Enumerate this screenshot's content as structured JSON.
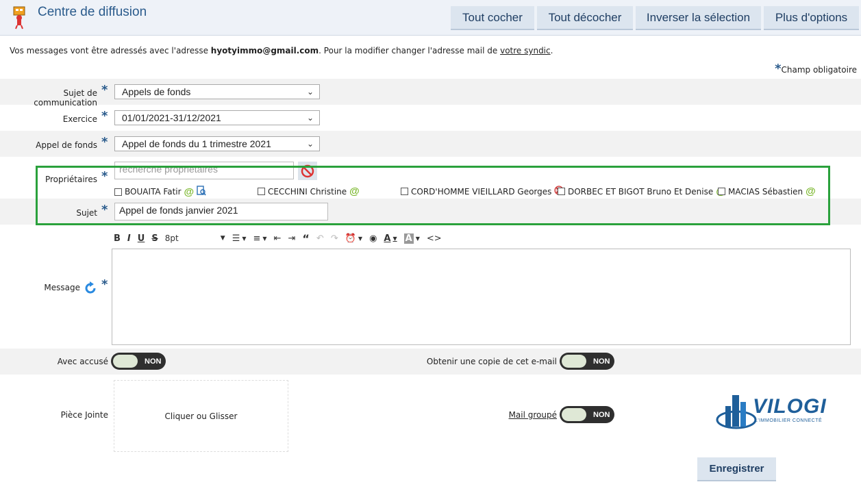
{
  "header": {
    "title": "Centre de diffusion",
    "buttons": {
      "check_all": "Tout cocher",
      "uncheck_all": "Tout décocher",
      "invert": "Inverser la sélection",
      "more": "Plus d'options"
    }
  },
  "notice": {
    "prefix": "Vos messages vont être adressés avec l'adresse ",
    "email": "hyotyimmo@gmail.com",
    "middle": ". Pour la modifier changer l'adresse mail de ",
    "link": "votre syndic",
    "suffix": "."
  },
  "required_note": "Champ obligatoire",
  "form": {
    "subject_type": {
      "label": "Sujet de communication",
      "value": "Appels de fonds"
    },
    "exercise": {
      "label": "Exercice",
      "value": "01/01/2021-31/12/2021"
    },
    "fund_call": {
      "label": "Appel de fonds",
      "value": "Appel de fonds du 1 trimestre 2021"
    },
    "owners": {
      "label": "Propriétaires",
      "search_placeholder": "recherche propriétaires",
      "items": [
        {
          "name": "BOUAITA Fatir",
          "icon": "at-icon",
          "extra_icon": "document-search-icon"
        },
        {
          "name": "CECCHINI Christine",
          "icon": "at-icon"
        },
        {
          "name": "CORD'HOMME VIEILLARD Georges",
          "icon": "no-email-icon"
        },
        {
          "name": "DORBEC ET BIGOT Bruno Et Denise",
          "icon": "at-icon"
        },
        {
          "name": "MACIAS Sébastien",
          "icon": "at-icon"
        }
      ]
    },
    "subject": {
      "label": "Sujet",
      "value": "Appel de fonds janvier 2021"
    },
    "message": {
      "label": "Message",
      "font_size": "8pt"
    },
    "ack": {
      "label": "Avec accusé",
      "state": "NON"
    },
    "copy": {
      "label": "Obtenir une copie de cet e-mail",
      "state": "NON"
    },
    "attachment": {
      "label": "Pièce Jointe",
      "drop_text": "Cliquer ou Glisser"
    },
    "grouped": {
      "label": "Mail groupé",
      "state": "NON"
    }
  },
  "logo": {
    "name": "VILOGI",
    "tagline": "L'IMMOBILIER CONNECTÉ"
  },
  "save_label": "Enregistrer",
  "colors": {
    "accent": "#2a5b8c",
    "highlight_box": "#2aa13c",
    "at": "#7cb82f"
  }
}
